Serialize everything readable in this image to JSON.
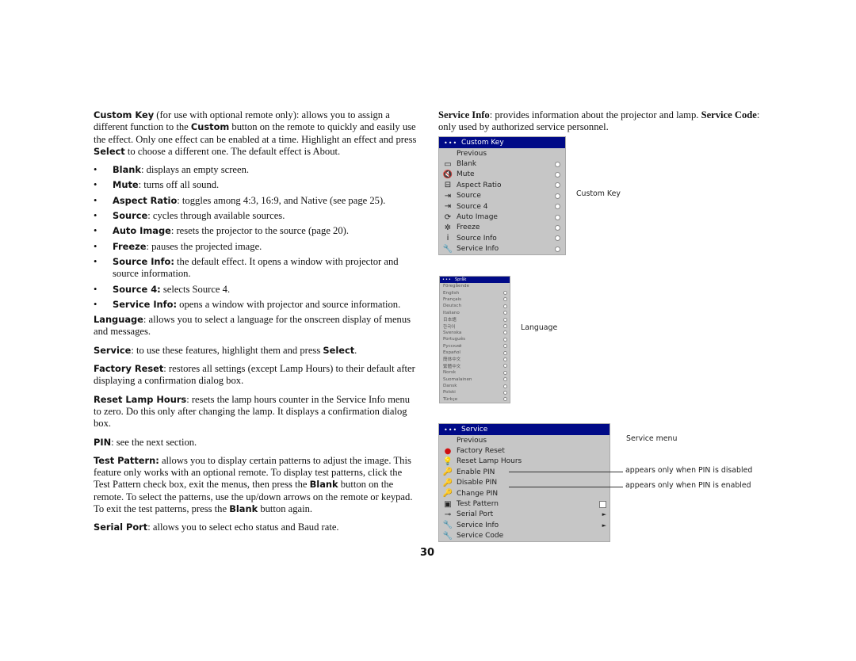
{
  "left_column": {
    "intro": {
      "term": "Custom Key",
      "text": " (for use with optional remote only): allows you to assign a different function to the ",
      "term2": "Custom",
      "text2": " button on the remote to quickly and easily use the effect. Only one effect can be enabled at a time. Highlight an effect and press ",
      "term3": "Select",
      "text3": " to choose a different one. The default effect is About."
    },
    "bullets": [
      {
        "term": "Blank",
        "text": ": displays an empty screen."
      },
      {
        "term": "Mute",
        "text": ": turns off all sound."
      },
      {
        "term": "Aspect Ratio",
        "text": ": toggles among 4:3, 16:9, and Native (see page 25)."
      },
      {
        "term": "Source",
        "text": ": cycles through available sources."
      },
      {
        "term": "Auto Image",
        "text": ": resets the projector to the source (page 20)."
      },
      {
        "term": "Freeze",
        "text": ": pauses the projected image."
      },
      {
        "term": "Source Info:",
        "text": " the default effect. It opens a window with projector and source information."
      },
      {
        "term": "Source 4:",
        "text": " selects Source 4."
      },
      {
        "term": "Service Info:",
        "text": " opens a window with projector and source information."
      }
    ],
    "language": {
      "term": "Language",
      "text": ": allows you to select a language for the onscreen display of menus and messages."
    },
    "service": {
      "term": "Service",
      "text": ": to use these features, highlight them and press ",
      "term2": "Select",
      "text2": "."
    },
    "factory_reset": {
      "term": "Factory Reset",
      "text": ": restores all settings (except Lamp Hours) to their default after displaying a confirmation dialog box."
    },
    "reset_lamp": {
      "term": "Reset Lamp Hours",
      "text": ": resets the lamp hours counter in the Service Info menu to zero. Do this only after changing the lamp. It displays a confirmation dialog box."
    },
    "pin": {
      "term": "PIN",
      "text": ": see the next section."
    },
    "test_pattern": {
      "term": "Test Pattern:",
      "text": " allows you to display certain patterns to adjust the image. This feature only works with an optional remote. To display test patterns, click the Test Pattern check box, exit the menus, then press the ",
      "term2": "Blank",
      "text2": " button on the remote. To select the patterns, use the up/down arrows on the remote or keypad. To exit the test patterns, press the ",
      "term3": "Blank",
      "text3": " button again."
    },
    "serial_port": {
      "term": "Serial Port",
      "text": ": allows you to select echo status and Baud rate."
    }
  },
  "right_column": {
    "intro": {
      "term": "Service Info",
      "text": ": provides information about the projector and lamp. ",
      "term2": "Service Code",
      "text2": ": only used by authorized service personnel."
    }
  },
  "custom_key_menu": {
    "title": "Custom Key",
    "dots": "•••",
    "caption": "Custom Key",
    "items": [
      {
        "label": "Previous",
        "icon": "",
        "radio": false
      },
      {
        "label": "Blank",
        "icon": "▭",
        "radio": true
      },
      {
        "label": "Mute",
        "icon": "🔇",
        "radio": true
      },
      {
        "label": "Aspect Ratio",
        "icon": "⊟",
        "radio": true
      },
      {
        "label": "Source",
        "icon": "⇥",
        "radio": true
      },
      {
        "label": "Source 4",
        "icon": "⇥",
        "radio": true
      },
      {
        "label": "Auto Image",
        "icon": "⟳",
        "radio": true
      },
      {
        "label": "Freeze",
        "icon": "✲",
        "radio": true
      },
      {
        "label": "Source Info",
        "icon": "i",
        "radio": true
      },
      {
        "label": "Service Info",
        "icon": "🔧",
        "radio": true
      }
    ]
  },
  "language_menu": {
    "title": "Språk",
    "dots": "•••",
    "caption": "Language",
    "items": [
      {
        "label": "Föregående",
        "radio": false
      },
      {
        "label": "English",
        "radio": true
      },
      {
        "label": "Français",
        "radio": true
      },
      {
        "label": "Deutsch",
        "radio": true
      },
      {
        "label": "Italiano",
        "radio": true
      },
      {
        "label": "日本語",
        "radio": true
      },
      {
        "label": "한국어",
        "radio": true
      },
      {
        "label": "Svenska",
        "radio": true
      },
      {
        "label": "Português",
        "radio": true
      },
      {
        "label": "Русский",
        "radio": true
      },
      {
        "label": "Español",
        "radio": true
      },
      {
        "label": "簡体中文",
        "radio": true
      },
      {
        "label": "繁體中文",
        "radio": true
      },
      {
        "label": "Norsk",
        "radio": true
      },
      {
        "label": "Suomalainen",
        "radio": true
      },
      {
        "label": "Dansk",
        "radio": true
      },
      {
        "label": "Polski",
        "radio": true
      },
      {
        "label": "Türkçe",
        "radio": true
      }
    ]
  },
  "service_menu": {
    "title": "Service",
    "dots": "•••",
    "caption": "Service menu",
    "items": [
      {
        "label": "Previous",
        "icon": "",
        "control": "none"
      },
      {
        "label": "Factory Reset",
        "icon": "●",
        "control": "none"
      },
      {
        "label": "Reset Lamp Hours",
        "icon": "💡",
        "control": "none"
      },
      {
        "label": "Enable PIN",
        "icon": "🔑",
        "control": "none"
      },
      {
        "label": "Disable PIN",
        "icon": "🔑",
        "control": "none"
      },
      {
        "label": "Change PIN",
        "icon": "🔑",
        "control": "none"
      },
      {
        "label": "Test Pattern",
        "icon": "▣",
        "control": "checkbox"
      },
      {
        "label": "Serial Port",
        "icon": "⊸",
        "control": "arrow"
      },
      {
        "label": "Service Info",
        "icon": "🔧",
        "control": "arrow"
      },
      {
        "label": "Service Code",
        "icon": "🔧",
        "control": "none"
      }
    ],
    "callouts": {
      "enable_pin": "appears only when PIN is disabled",
      "disable_pin": "appears only when PIN is enabled"
    },
    "arrow_glyph": "►"
  },
  "page_number": "30",
  "colors": {
    "menu_header": "#000a87",
    "menu_body": "#c6c6c6",
    "factory_reset_icon": "#d01010"
  }
}
